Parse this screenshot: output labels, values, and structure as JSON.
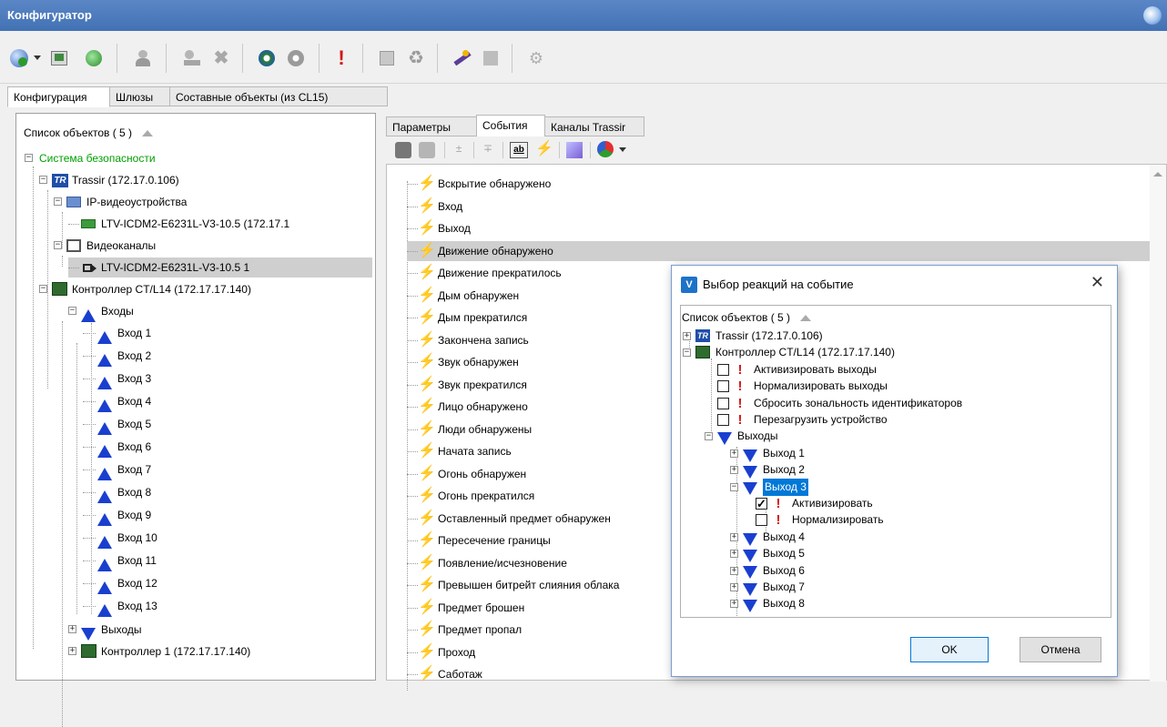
{
  "window": {
    "title": "Конфигуратор",
    "app_icon": "configurator-globe-icon"
  },
  "toolbar": {
    "buttons": [
      "add-object-icon",
      "chevron-down-icon",
      "import-icon",
      "refresh-icon",
      "user-icon",
      "edit-icon",
      "delete-icon",
      "settings-icon",
      "settings-disabled-icon",
      "alarm-icon",
      "export-icon",
      "recycle-icon",
      "wand-icon",
      "grid-icon",
      "network-icon"
    ]
  },
  "main_tabs": [
    "Конфигурация",
    "Шлюзы",
    "Составные объекты (из CL15)"
  ],
  "left_tree": {
    "header": "Список объектов ( 5 )",
    "sort_icon": "sort-up-icon",
    "items": [
      {
        "label": "Система безопасности",
        "color": "#00a000"
      },
      {
        "label": "Trassir (172.17.0.106)"
      },
      {
        "label": "IP-видеоустройства"
      },
      {
        "label": "LTV-ICDM2-E6231L-V3-10.5 (172.17.1"
      },
      {
        "label": "Видеоканалы"
      },
      {
        "label": "LTV-ICDM2-E6231L-V3-10.5 1"
      },
      {
        "label": "Контроллер CT/L14 (172.17.17.140)"
      },
      {
        "label": "Входы"
      },
      {
        "label": "Вход 1"
      },
      {
        "label": "Вход 2"
      },
      {
        "label": "Вход 3"
      },
      {
        "label": "Вход 4"
      },
      {
        "label": "Вход 5"
      },
      {
        "label": "Вход 6"
      },
      {
        "label": "Вход 7"
      },
      {
        "label": "Вход 8"
      },
      {
        "label": "Вход 9"
      },
      {
        "label": "Вход 10"
      },
      {
        "label": "Вход 11"
      },
      {
        "label": "Вход 12"
      },
      {
        "label": "Вход 13"
      },
      {
        "label": "Выходы"
      },
      {
        "label": "Контроллер 1 (172.17.17.140)"
      }
    ]
  },
  "right_tabs": [
    "Параметры",
    "События",
    "Каналы Trassir"
  ],
  "events_toolbar": [
    "add-event-icon",
    "user-event-icon",
    "move-up-icon",
    "move-down-icon",
    "rename-icon",
    "reaction-icon",
    "script-icon",
    "color-icon",
    "chevron-down-icon"
  ],
  "events": [
    "Вскрытие обнаружено",
    "Вход",
    "Выход",
    "Движение обнаружено",
    "Движение прекратилось",
    "Дым обнаружен",
    "Дым прекратился",
    "Закончена запись",
    "Звук обнаружен",
    "Звук прекратился",
    "Лицо обнаружено",
    "Люди обнаружены",
    "Начата запись",
    "Огонь обнаружен",
    "Огонь прекратился",
    "Оставленный предмет обнаружен",
    "Пересечение границы",
    "Появление/исчезновение",
    "Превышен битрейт слияния облака",
    "Предмет брошен",
    "Предмет пропал",
    "Проход",
    "Саботаж"
  ],
  "selected_event": "Движение обнаружено",
  "dialog": {
    "title": "Выбор реакций на событие",
    "header": "Список объектов ( 5 )",
    "items": [
      "Trassir (172.17.0.106)",
      "Контроллер CT/L14 (172.17.17.140)",
      "Активизировать выходы",
      "Нормализировать выходы",
      "Сбросить зональность идентификаторов",
      "Перезагрузить устройство",
      "Выходы",
      "Выход 1",
      "Выход 2",
      "Выход 3",
      "Активизировать",
      "Нормализировать",
      "Выход 4",
      "Выход 5",
      "Выход 6",
      "Выход 7",
      "Выход 8"
    ],
    "ok_label": "OK",
    "cancel_label": "Отмена",
    "close_label": "✕"
  }
}
